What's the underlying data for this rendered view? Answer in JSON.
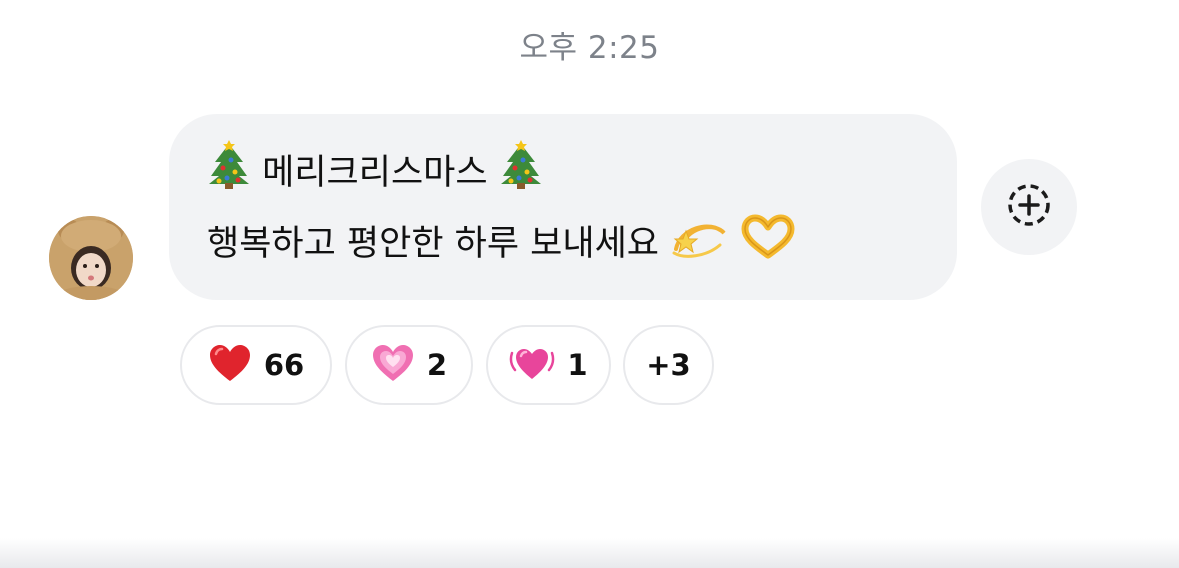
{
  "timestamp": "오후 2:25",
  "message": {
    "line1_text": "메리크리스마스",
    "line2_text": "행복하고 평안한 하루 보내세요",
    "emoji": [
      "christmas-tree-icon",
      "dizzy-star-icon",
      "heart-hands-icon"
    ]
  },
  "add_reaction": {
    "icon": "add-reaction-icon"
  },
  "reactions": [
    {
      "icon": "red-heart-icon",
      "count": "66"
    },
    {
      "icon": "pink-heart-icon",
      "count": "2"
    },
    {
      "icon": "beating-heart-icon",
      "count": "1"
    }
  ],
  "more_reactions": "+3",
  "colors": {
    "bubble": "#f2f3f5",
    "timestamp": "#7d828a",
    "chip_border": "#e8e9ec"
  }
}
